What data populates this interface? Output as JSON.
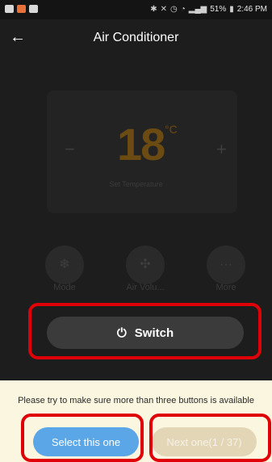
{
  "status_bar": {
    "battery_percent": "51%",
    "time": "2:46 PM",
    "left_icons": [
      "gallery-icon",
      "app-icon",
      "folder-icon"
    ],
    "right_icons": [
      "bluetooth-icon",
      "mute-icon",
      "alarm-icon",
      "wifi-icon",
      "signal-icon",
      "battery-icon"
    ]
  },
  "header": {
    "title": "Air Conditioner"
  },
  "temperature": {
    "value": "18",
    "unit": "°C",
    "label": "Set Temperature",
    "decrease": "−",
    "increase": "+"
  },
  "controls": [
    {
      "name": "mode",
      "label": "Mode",
      "icon": "snowflake-icon",
      "glyph": "❄"
    },
    {
      "name": "air-volume",
      "label": "Air Volu...",
      "icon": "fan-icon",
      "glyph": "✣"
    },
    {
      "name": "more",
      "label": "More",
      "icon": "more-icon",
      "glyph": "···"
    }
  ],
  "switch": {
    "label": "Switch",
    "icon": "power-icon",
    "glyph": "⏻"
  },
  "sheet": {
    "hint": "Please try to make sure more than three buttons is available",
    "select_label": "Select this one",
    "next_label": "Next one(1 / 37)"
  },
  "colors": {
    "highlight": "#e00008",
    "select_button": "#5aa6e6",
    "next_button_disabled": "#e2d6b6",
    "sheet_background": "#fbf6df"
  }
}
